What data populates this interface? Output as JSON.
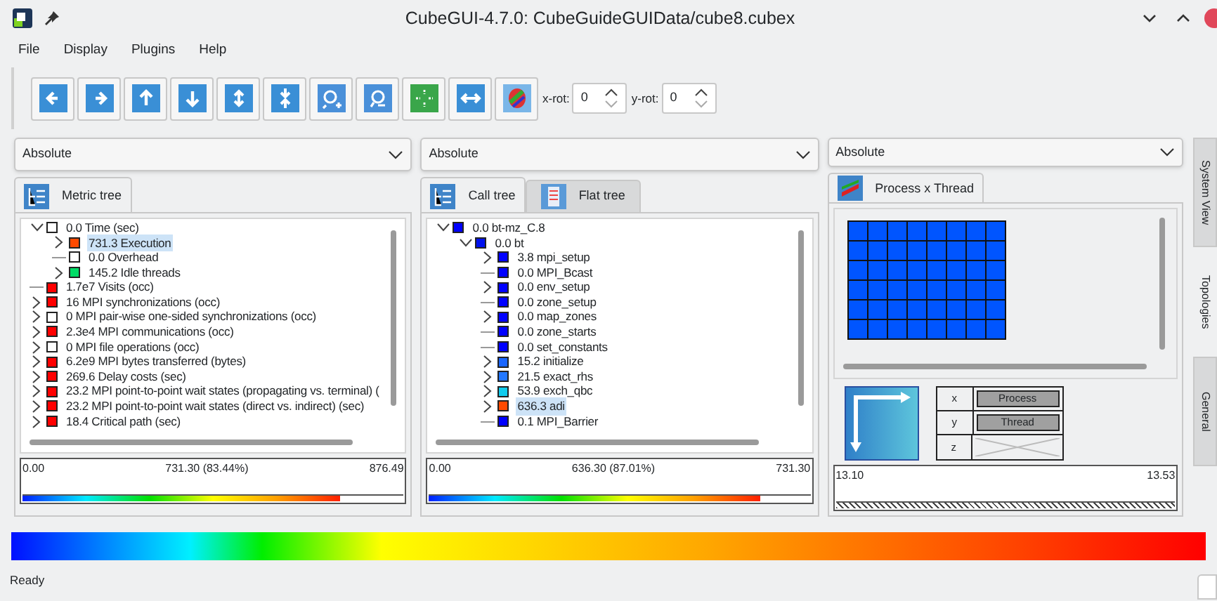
{
  "window": {
    "title": "CubeGUI-4.7.0: CubeGuideGUIData/cube8.cubex"
  },
  "menu": [
    "File",
    "Display",
    "Plugins",
    "Help"
  ],
  "toolbar": {
    "x_rot": {
      "label": "x-rot:",
      "value": "0"
    },
    "y_rot": {
      "label": "y-rot:",
      "value": "0"
    }
  },
  "panels": [
    {
      "mode": "Absolute",
      "tabs": [
        {
          "label": "Metric tree",
          "selected": true
        }
      ],
      "tree": [
        {
          "label": "0.0 Time (sec)",
          "color": "#ffffff",
          "kind": "open",
          "selected": false,
          "children": [
            {
              "label": "731.3 Execution",
              "color": "#ff4a00",
              "kind": "closed",
              "selected": true
            },
            {
              "label": "0.0 Overhead",
              "color": "#ffffff",
              "kind": "leaf",
              "selected": false
            },
            {
              "label": "145.2 Idle threads",
              "color": "#00dd66",
              "kind": "closed",
              "selected": false
            }
          ]
        },
        {
          "label": "1.7e7 Visits (occ)",
          "color": "#ff0000",
          "kind": "leaf",
          "selected": false
        },
        {
          "label": "16 MPI synchronizations (occ)",
          "color": "#ff0000",
          "kind": "closed",
          "selected": false
        },
        {
          "label": "0 MPI pair-wise one-sided synchronizations (occ)",
          "color": "#ffffff",
          "kind": "closed",
          "selected": false
        },
        {
          "label": "2.3e4 MPI communications (occ)",
          "color": "#ff0000",
          "kind": "closed",
          "selected": false
        },
        {
          "label": "0 MPI file operations (occ)",
          "color": "#ffffff",
          "kind": "closed",
          "selected": false
        },
        {
          "label": "6.2e9 MPI bytes transferred (bytes)",
          "color": "#ff0000",
          "kind": "closed",
          "selected": false
        },
        {
          "label": "269.6 Delay costs (sec)",
          "color": "#ff0000",
          "kind": "closed",
          "selected": false
        },
        {
          "label": "23.2 MPI point-to-point wait states (propagating vs. terminal) (",
          "color": "#ff0000",
          "kind": "closed",
          "selected": false
        },
        {
          "label": "23.2 MPI point-to-point wait states (direct vs. indirect) (sec)",
          "color": "#ff0000",
          "kind": "closed",
          "selected": false
        },
        {
          "label": "18.4 Critical path (sec)",
          "color": "#ff0000",
          "kind": "closed",
          "selected": false
        }
      ],
      "scale": {
        "min": "0.00",
        "value": "731.30 (83.44%)",
        "max": "876.49",
        "level": 0.8344
      }
    },
    {
      "mode": "Absolute",
      "tabs": [
        {
          "label": "Call tree",
          "selected": true
        },
        {
          "label": "Flat tree",
          "selected": false
        }
      ],
      "tree": [
        {
          "label": "0.0 bt-mz_C.8",
          "color": "#0000ff",
          "kind": "open",
          "selected": false,
          "children": [
            {
              "label": "0.0 bt",
              "color": "#0011ee",
              "kind": "open",
              "selected": false,
              "children": [
                {
                  "label": "3.8 mpi_setup",
                  "color": "#0000ff",
                  "kind": "closed",
                  "selected": false
                },
                {
                  "label": "0.0 MPI_Bcast",
                  "color": "#0000ff",
                  "kind": "leaf",
                  "selected": false
                },
                {
                  "label": "0.0 env_setup",
                  "color": "#0000ff",
                  "kind": "closed",
                  "selected": false
                },
                {
                  "label": "0.0 zone_setup",
                  "color": "#0000ff",
                  "kind": "leaf",
                  "selected": false
                },
                {
                  "label": "0.0 map_zones",
                  "color": "#0000ff",
                  "kind": "closed",
                  "selected": false
                },
                {
                  "label": "0.0 zone_starts",
                  "color": "#0000ff",
                  "kind": "leaf",
                  "selected": false
                },
                {
                  "label": "0.0 set_constants",
                  "color": "#0000ff",
                  "kind": "leaf",
                  "selected": false
                },
                {
                  "label": "15.2 initialize",
                  "color": "#1a66ff",
                  "kind": "closed",
                  "selected": false
                },
                {
                  "label": "21.5 exact_rhs",
                  "color": "#2277ff",
                  "kind": "closed",
                  "selected": false
                },
                {
                  "label": "53.9 exch_qbc",
                  "color": "#11ccee",
                  "kind": "closed",
                  "selected": false
                },
                {
                  "label": "636.3 adi",
                  "color": "#ff4a00",
                  "kind": "closed",
                  "selected": true
                },
                {
                  "label": "0.1 MPI_Barrier",
                  "color": "#0000ff",
                  "kind": "leaf",
                  "selected": false
                }
              ]
            }
          ]
        }
      ],
      "scale": {
        "min": "0.00",
        "value": "636.30 (87.01%)",
        "max": "731.30",
        "level": 0.8701
      }
    },
    {
      "mode": "Absolute",
      "tabs": [
        {
          "label": "Process x Thread",
          "selected": true
        }
      ],
      "grid": {
        "color": "#0055ff"
      },
      "axes": [
        {
          "axis": "x",
          "value": "Process"
        },
        {
          "axis": "y",
          "value": "Thread"
        },
        {
          "axis": "z"
        }
      ],
      "scale": {
        "min": "13.10",
        "max": "13.53"
      }
    }
  ],
  "side_tabs": [
    {
      "label": "System View",
      "selected": false
    },
    {
      "label": "Topologies",
      "selected": true
    },
    {
      "label": "General",
      "selected": false
    }
  ],
  "status_bar": {
    "text": "Ready"
  }
}
